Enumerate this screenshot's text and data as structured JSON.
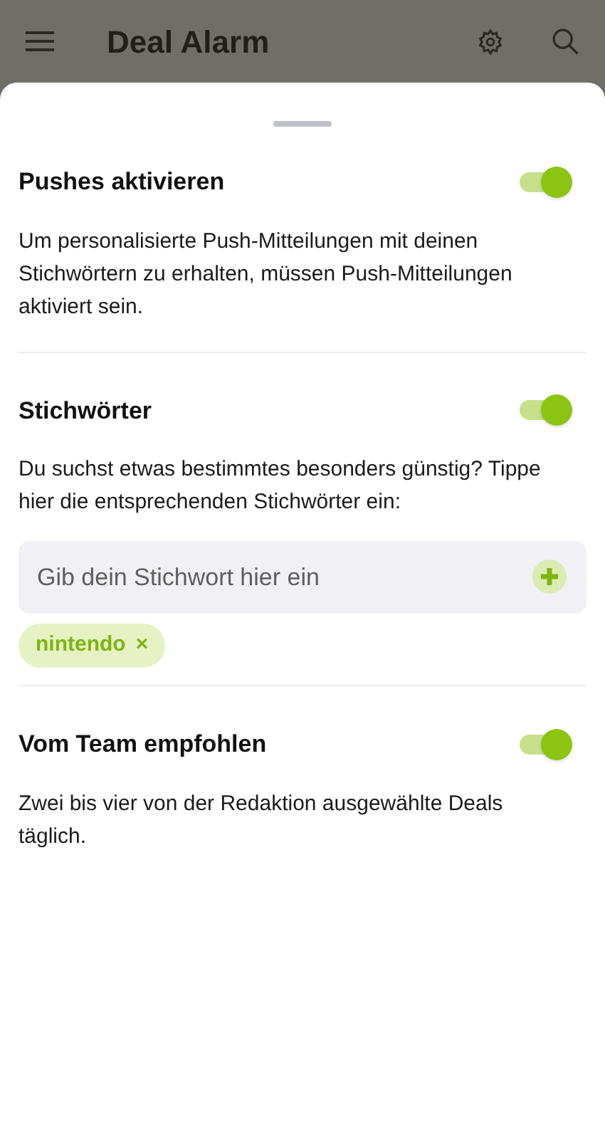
{
  "app_bar": {
    "title": "Deal Alarm"
  },
  "sections": [
    {
      "kind": "plain",
      "title": "Pushes aktivieren",
      "on": true,
      "description": "Um personalisierte Push-Mitteilungen mit deinen Stichwörtern zu erhalten, müssen Push-Mitteilungen aktiviert sein."
    },
    {
      "kind": "keywords",
      "title": "Stichwörter",
      "on": true,
      "description": "Du suchst etwas bestimmtes besonders günstig? Tippe hier die entsprechenden Stichwörter ein:",
      "input": {
        "placeholder": "Gib dein Stichwort hier ein"
      },
      "tags": [
        {
          "label": "nintendo",
          "remove": "×"
        }
      ]
    },
    {
      "kind": "plain",
      "title": "Vom Team empfohlen",
      "on": true,
      "description": "Zwei bis vier von der Redaktion ausgewählte Deals täglich."
    }
  ]
}
